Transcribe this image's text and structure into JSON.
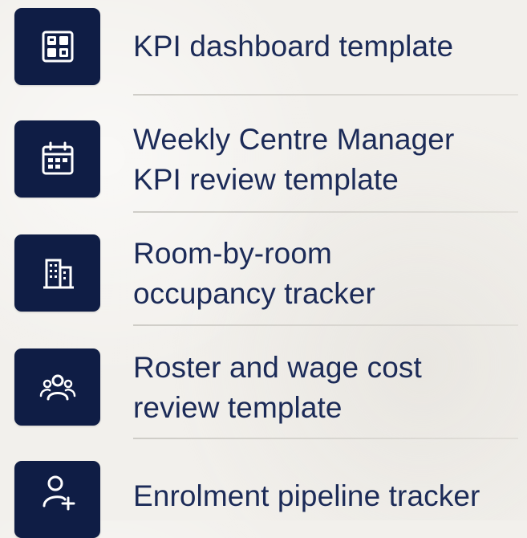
{
  "items": [
    {
      "label": "KPI dashboard template",
      "icon": "dashboard-grid-icon"
    },
    {
      "label": "Weekly Centre Manager KPI review template",
      "line1": "Weekly Centre Manager",
      "line2": "KPI review template",
      "icon": "calendar-icon"
    },
    {
      "label": "Room-by-room occupancy tracker",
      "line1": "Room-by-room",
      "line2": "occupancy tracker",
      "icon": "building-icon"
    },
    {
      "label": "Roster and wage cost review template",
      "line1": "Roster and wage cost",
      "line2": "review template",
      "icon": "team-icon"
    },
    {
      "label": "Enrolment pipeline tracker",
      "icon": "add-user-icon"
    }
  ],
  "colors": {
    "tile": "#0f1d45",
    "text": "#1c2b58",
    "background": "#f2f0ec"
  }
}
